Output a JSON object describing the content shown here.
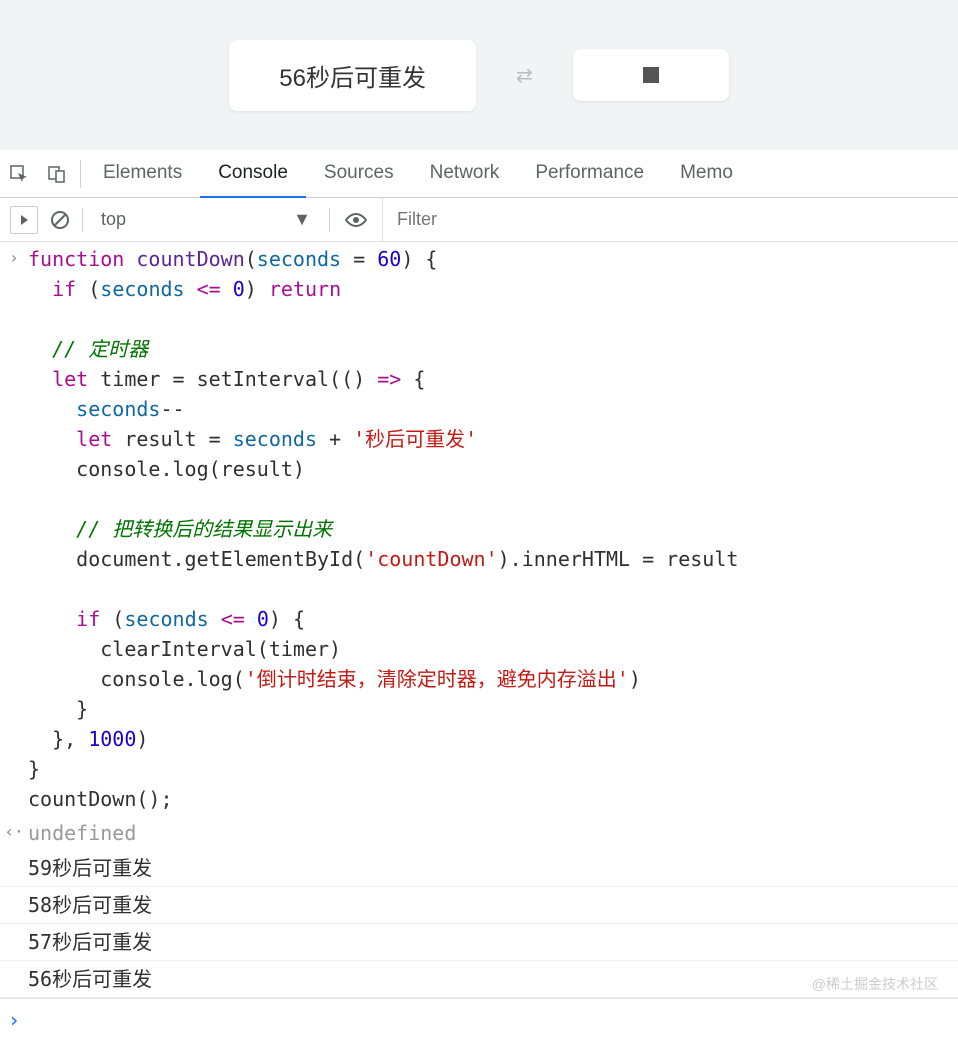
{
  "preview": {
    "button1_text": "56秒后可重发"
  },
  "tabs": {
    "elements": "Elements",
    "console": "Console",
    "sources": "Sources",
    "network": "Network",
    "performance": "Performance",
    "memory": "Memo"
  },
  "toolbar": {
    "context": "top",
    "filter_placeholder": "Filter"
  },
  "code": {
    "l1a": "function",
    "l1b": " countDown",
    "l1c": "(",
    "l1d": "seconds",
    "l1e": " = ",
    "l1f": "60",
    "l1g": ") {",
    "l2a": "  ",
    "l2b": "if",
    "l2c": " (",
    "l2d": "seconds",
    "l2e": " <= ",
    "l2f": "0",
    "l2g": ") ",
    "l2h": "return",
    "l3": "",
    "l4a": "  ",
    "l4b": "// 定时器",
    "l5a": "  ",
    "l5b": "let",
    "l5c": " timer = setInterval(() ",
    "l5d": "=>",
    "l5e": " {",
    "l6a": "    ",
    "l6b": "seconds",
    "l6c": "--",
    "l7a": "    ",
    "l7b": "let",
    "l7c": " result = ",
    "l7d": "seconds",
    "l7e": " + ",
    "l7f": "'秒后可重发'",
    "l8": "    console.log(result)",
    "l9": "",
    "l10a": "    ",
    "l10b": "// 把转换后的结果显示出来",
    "l11a": "    document.getElementById(",
    "l11b": "'countDown'",
    "l11c": ").innerHTML = result",
    "l12": "",
    "l13a": "    ",
    "l13b": "if",
    "l13c": " (",
    "l13d": "seconds",
    "l13e": " <= ",
    "l13f": "0",
    "l13g": ") {",
    "l14": "      clearInterval(timer)",
    "l15a": "      console.log(",
    "l15b": "'倒计时结束，清除定时器，避免内存溢出'",
    "l15c": ")",
    "l16": "    }",
    "l17a": "  }, ",
    "l17b": "1000",
    "l17c": ")",
    "l18": "}",
    "l19": "countDown();"
  },
  "output": {
    "undefined": "undefined",
    "log1": "59秒后可重发",
    "log2": "58秒后可重发",
    "log3": "57秒后可重发",
    "log4": "56秒后可重发"
  },
  "watermark": "@稀土掘金技术社区"
}
